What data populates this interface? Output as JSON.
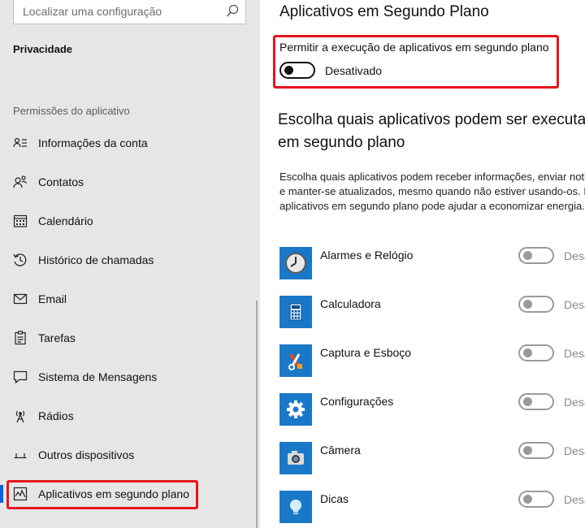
{
  "sidebar": {
    "search_placeholder": "Localizar uma configuração",
    "home": "Privacidade",
    "section": "Permissões do aplicativo",
    "items": [
      {
        "label": "Informações da conta",
        "icon": "account-info-icon"
      },
      {
        "label": "Contatos",
        "icon": "contacts-icon"
      },
      {
        "label": "Calendário",
        "icon": "calendar-icon"
      },
      {
        "label": "Histórico de chamadas",
        "icon": "call-history-icon"
      },
      {
        "label": "Email",
        "icon": "email-icon"
      },
      {
        "label": "Tarefas",
        "icon": "tasks-icon"
      },
      {
        "label": "Sistema de Mensagens",
        "icon": "messaging-icon"
      },
      {
        "label": "Rádios",
        "icon": "radios-icon"
      },
      {
        "label": "Outros dispositivos",
        "icon": "other-devices-icon"
      },
      {
        "label": "Aplicativos em segundo plano",
        "icon": "background-apps-icon",
        "selected": true
      }
    ]
  },
  "main": {
    "title": "Aplicativos em Segundo Plano",
    "master_toggle": {
      "label": "Permitir a execução de aplicativos em segundo plano",
      "state": "Desativado",
      "on": false
    },
    "heading": "Escolha quais aplicativos podem ser executados em segundo plano",
    "description": "Escolha quais aplicativos podem receber informações, enviar notificações e manter-se atualizados, mesmo quando não estiver usando-os. Desativar aplicativos em segundo plano pode ajudar a economizar energia.",
    "apps": [
      {
        "name": "Alarmes e Relógio",
        "state": "Desativado",
        "icon": "alarm-clock-icon"
      },
      {
        "name": "Calculadora",
        "state": "Desativado",
        "icon": "calculator-icon"
      },
      {
        "name": "Captura e Esboço",
        "state": "Desativado",
        "icon": "snip-sketch-icon"
      },
      {
        "name": "Configurações",
        "state": "Desativado",
        "icon": "gear-icon"
      },
      {
        "name": "Câmera",
        "state": "Desativado",
        "icon": "camera-icon"
      },
      {
        "name": "Dicas",
        "state": "Desativado",
        "icon": "lightbulb-icon"
      }
    ]
  },
  "colors": {
    "accent": "#0a64d7",
    "highlight": "#e8141d",
    "app_tile": "#1a78c8",
    "sidebar_bg": "#e6e6e6"
  }
}
